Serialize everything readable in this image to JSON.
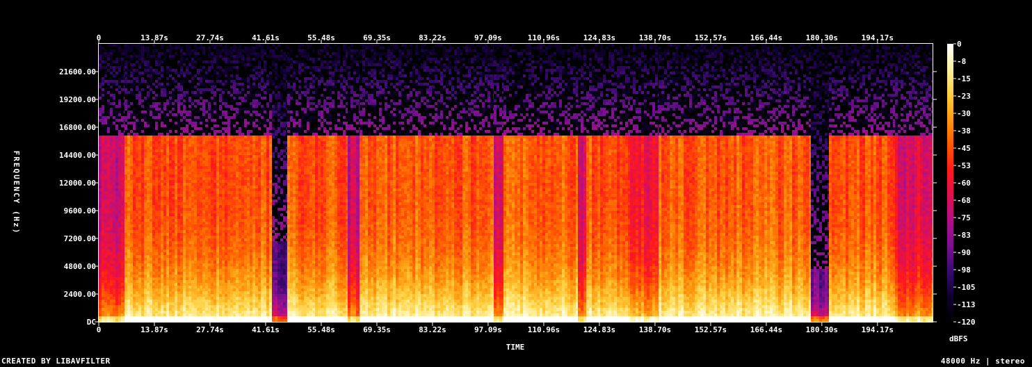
{
  "chart_data": {
    "type": "heatmap",
    "title": "",
    "xlabel": "TIME",
    "ylabel": "FREQUENCY (Hz)",
    "x_tick_labels": [
      "0",
      "13.87s",
      "27.74s",
      "41.61s",
      "55.48s",
      "69.35s",
      "83.22s",
      "97.09s",
      "110.96s",
      "124.83s",
      "138.70s",
      "152.57s",
      "166.44s",
      "180.30s",
      "194.17s"
    ],
    "x_tick_values": [
      0,
      13.87,
      27.74,
      41.61,
      55.48,
      69.35,
      83.22,
      97.09,
      110.96,
      124.83,
      138.7,
      152.57,
      166.44,
      180.3,
      194.17
    ],
    "xlim": [
      0,
      207.9
    ],
    "y_tick_labels": [
      "DC",
      "2400.00",
      "4800.00",
      "7200.00",
      "9600.00",
      "12000.00",
      "14400.00",
      "16800.00",
      "19200.00",
      "21600.00"
    ],
    "y_tick_values": [
      0,
      2400,
      4800,
      7200,
      9600,
      12000,
      14400,
      16800,
      19200,
      21600
    ],
    "ylim": [
      0,
      24000
    ],
    "colorbar_label": "dBFS",
    "colorbar_tick_labels": [
      "0",
      "-8",
      "-15",
      "-23",
      "-30",
      "-38",
      "-45",
      "-53",
      "-60",
      "-68",
      "-75",
      "-83",
      "-90",
      "-98",
      "-105",
      "-113",
      "-120"
    ],
    "colorbar_range": [
      -120,
      0
    ],
    "colormap": [
      "#000000",
      "#100030",
      "#3a0a70",
      "#7a1090",
      "#b0108a",
      "#e01050",
      "#ff1a1a",
      "#ff5a00",
      "#ff9a10",
      "#ffd040",
      "#fff0a0",
      "#ffffff"
    ],
    "segments": [
      {
        "start": 0,
        "end": 6.5,
        "cutoff": 16000,
        "level": 0.42
      },
      {
        "start": 6.5,
        "end": 43.2,
        "cutoff": 16000,
        "level": 0.62
      },
      {
        "start": 43.2,
        "end": 47.0,
        "cutoff": 7000,
        "level": 0.22
      },
      {
        "start": 47.0,
        "end": 62.0,
        "cutoff": 16000,
        "level": 0.62
      },
      {
        "start": 62.0,
        "end": 65.0,
        "cutoff": 16000,
        "level": 0.4
      },
      {
        "start": 65.0,
        "end": 98.5,
        "cutoff": 16000,
        "level": 0.63
      },
      {
        "start": 98.5,
        "end": 101.0,
        "cutoff": 16000,
        "level": 0.45
      },
      {
        "start": 101.0,
        "end": 119.5,
        "cutoff": 16000,
        "level": 0.63
      },
      {
        "start": 119.5,
        "end": 121.5,
        "cutoff": 16000,
        "level": 0.45
      },
      {
        "start": 121.5,
        "end": 132.5,
        "cutoff": 16000,
        "level": 0.62
      },
      {
        "start": 132.5,
        "end": 139.5,
        "cutoff": 16000,
        "level": 0.5
      },
      {
        "start": 139.5,
        "end": 177.5,
        "cutoff": 16000,
        "level": 0.63
      },
      {
        "start": 177.5,
        "end": 182.0,
        "cutoff": 4500,
        "level": 0.25
      },
      {
        "start": 182.0,
        "end": 198.5,
        "cutoff": 16000,
        "level": 0.62
      },
      {
        "start": 198.5,
        "end": 207.9,
        "cutoff": 16000,
        "level": 0.45
      }
    ]
  },
  "footer": {
    "left": "CREATED BY LIBAVFILTER",
    "right": "48000 Hz | stereo"
  }
}
